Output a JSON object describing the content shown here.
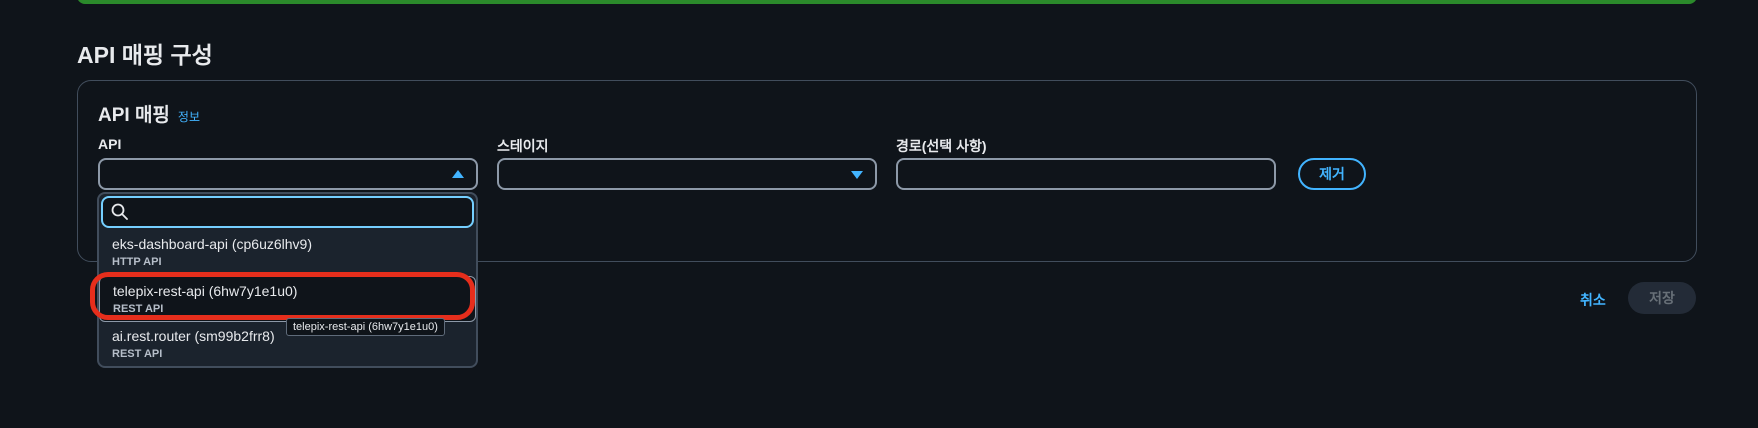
{
  "section": {
    "title": "API 매핑 구성"
  },
  "panel": {
    "title": "API 매핑",
    "info_link": "정보",
    "fields": {
      "api_label": "API",
      "stage_label": "스테이지",
      "path_label": "경로(선택 사항)",
      "api_value": "",
      "stage_value": "",
      "path_value": ""
    },
    "remove_label": "제거"
  },
  "dropdown": {
    "search_placeholder": "",
    "options": [
      {
        "name": "eks-dashboard-api (cp6uz6lhv9)",
        "type": "HTTP API"
      },
      {
        "name": "telepix-rest-api (6hw7y1e1u0)",
        "type": "REST API"
      },
      {
        "name": "ai.rest.router (sm99b2frr8)",
        "type": "REST API"
      }
    ],
    "tooltip": "telepix-rest-api (6hw7y1e1u0)"
  },
  "footer": {
    "cancel_label": "취소",
    "save_label": "저장"
  },
  "colors": {
    "accent": "#42b4ff",
    "annotation": "#e62e1c",
    "success": "#2b8a2b"
  }
}
